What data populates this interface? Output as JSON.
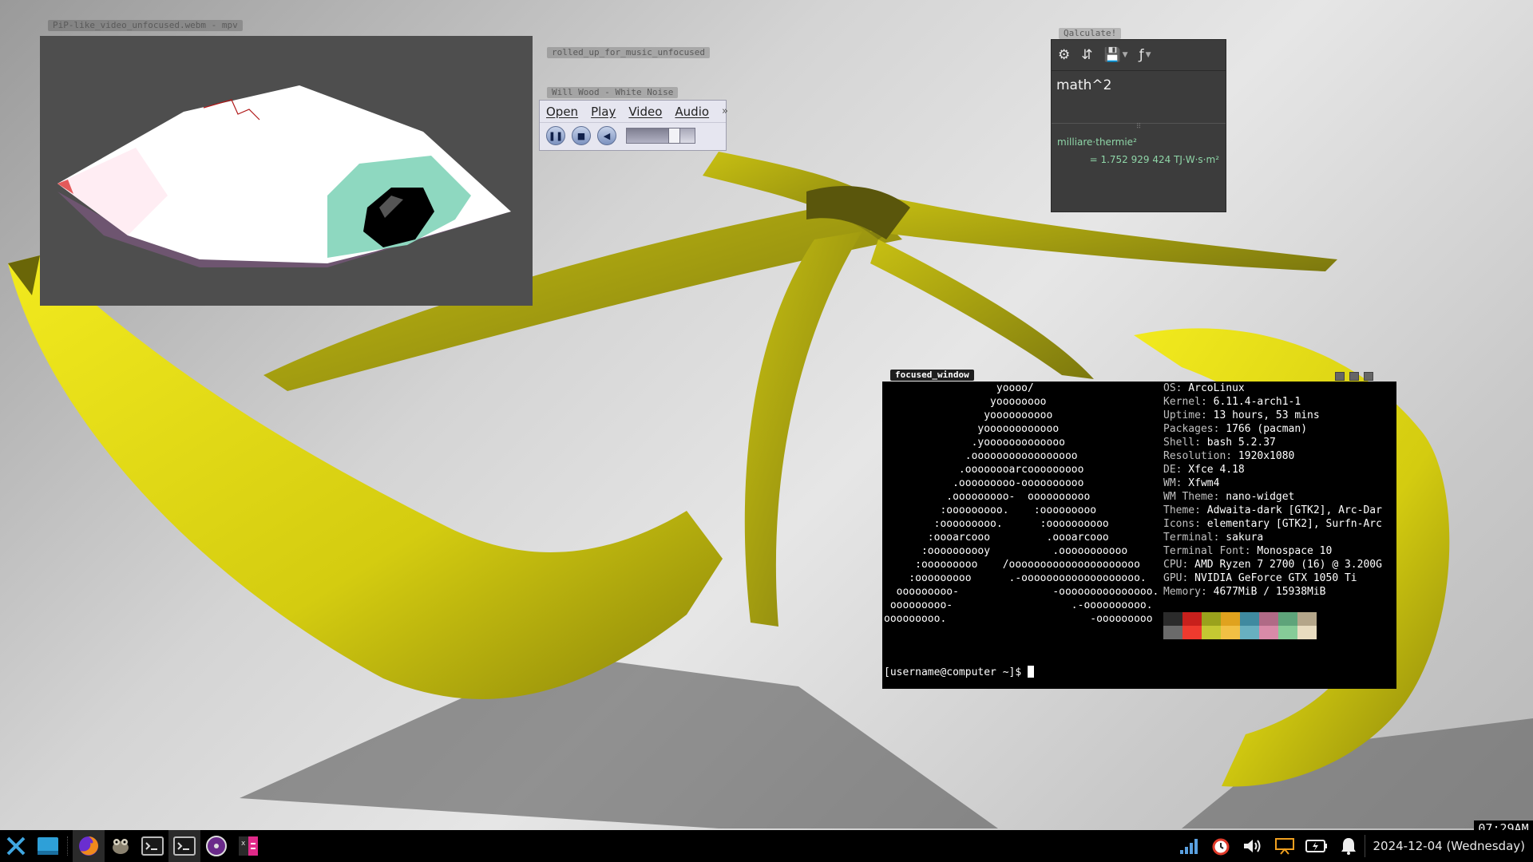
{
  "windows": {
    "mpv": {
      "title": "PiP-like_video_unfocused.webm - mpv"
    },
    "rolled_up": {
      "title": "rolled_up_for_music_unfocused"
    },
    "music": {
      "title": "Will Wood - White Noise",
      "menu": [
        "Open",
        "Play",
        "Video",
        "Audio"
      ],
      "more_glyph": "»",
      "volume_fraction": 0.72
    },
    "qalculate": {
      "title": "Qalculate!",
      "input": "math^2",
      "result_parsed": "milliare·thermie²",
      "result_value": "= 1.752 929 424 TJ·W·s·m²"
    },
    "terminal": {
      "title": "focused_window",
      "ascii_art": "                  yoooo/\n                 yoooooooo\n                yoooooooooo\n               yoooooooooooo\n              .yooooooooooooo\n             .ooooooooooooooooo\n            .oooooooarcooooooooo\n           .ooooooooo-oooooooooo\n          .ooooooooo-  oooooooooo\n         :ooooooooo.    :ooooooooo\n        :ooooooooo.      :oooooooooo\n       :oooarcooo         .oooarcooo\n      :oooooooooy          .ooooooooooo\n     :ooooooooo    /ooooooooooooooooooooo\n    :ooooooooo      .-ooooooooooooooooooo.\n  ooooooooo-               -ooooooooooooooo.\n ooooooooo-                   .-oooooooooo.\nooooooooo.                       -ooooooooo",
      "info": [
        {
          "key": "OS:",
          "value": " ArcoLinux"
        },
        {
          "key": "Kernel:",
          "value": " 6.11.4-arch1-1"
        },
        {
          "key": "Uptime:",
          "value": " 13 hours, 53 mins"
        },
        {
          "key": "Packages:",
          "value": " 1766 (pacman)"
        },
        {
          "key": "Shell:",
          "value": " bash 5.2.37"
        },
        {
          "key": "Resolution:",
          "value": " 1920x1080"
        },
        {
          "key": "DE:",
          "value": " Xfce 4.18"
        },
        {
          "key": "WM:",
          "value": " Xfwm4"
        },
        {
          "key": "WM Theme:",
          "value": " nano-widget"
        },
        {
          "key": "Theme:",
          "value": " Adwaita-dark [GTK2], Arc-Dar"
        },
        {
          "key": "Icons:",
          "value": " elementary [GTK2], Surfn-Arc"
        },
        {
          "key": "Terminal:",
          "value": " sakura"
        },
        {
          "key": "Terminal Font:",
          "value": " Monospace 10"
        },
        {
          "key": "CPU:",
          "value": " AMD Ryzen 7 2700 (16) @ 3.200G"
        },
        {
          "key": "GPU:",
          "value": " NVIDIA GeForce GTX 1050 Ti"
        },
        {
          "key": "Memory:",
          "value": " 4677MiB / 15938MiB"
        }
      ],
      "palette": [
        "#2b2b2b",
        "#c8201c",
        "#9aa21c",
        "#e0a21e",
        "#3f8aa0",
        "#b06a86",
        "#5ea47a",
        "#b4a68a",
        "#6a6a6a",
        "#ee3a2e",
        "#c4c832",
        "#f2c044",
        "#68b0c0",
        "#d88aa8",
        "#86cc98",
        "#e8dcc0"
      ],
      "prompt": "[username@computer ~]$ "
    }
  },
  "clock": "07:29AM",
  "taskbar": {
    "apps": [
      "whisker-menu-icon",
      "show-desktop-icon",
      "firefox-icon",
      "gimp-icon",
      "terminal-icon",
      "terminal-icon",
      "media-player-icon",
      "qalculate-icon"
    ],
    "tray_icons": [
      "network-signal-icon",
      "alarm-clock-icon",
      "volume-icon",
      "presentation-icon",
      "battery-icon",
      "notification-bell-icon"
    ],
    "date": "2024-12-04 (Wednesday)"
  }
}
